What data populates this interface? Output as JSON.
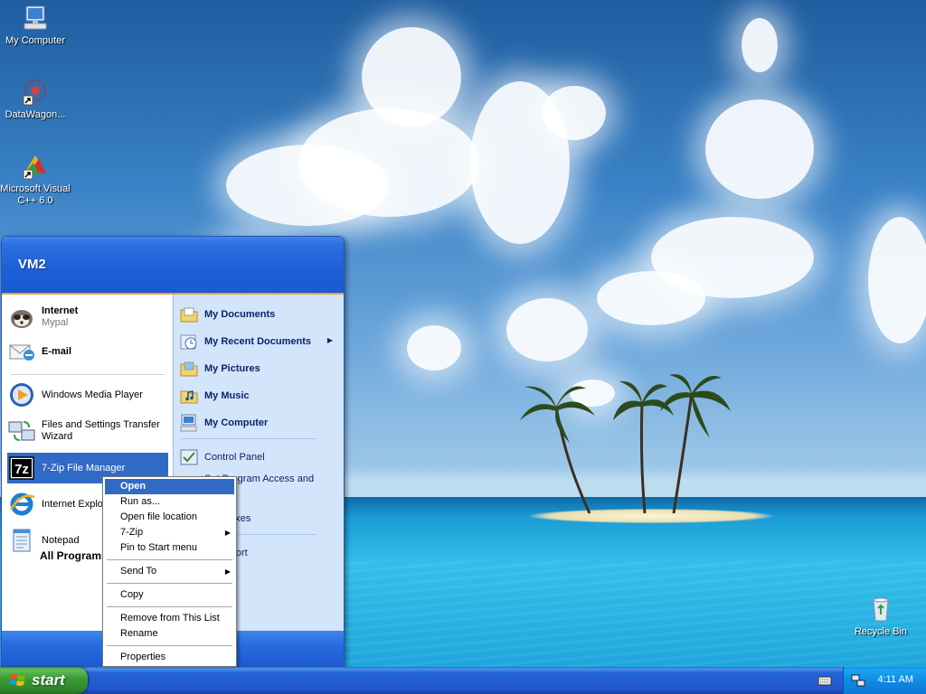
{
  "desktop": {
    "icons": [
      {
        "label": "My Computer"
      },
      {
        "label": "DataWagon..."
      },
      {
        "label": "Microsoft Visual C++ 6.0"
      },
      {
        "label": "Recycle Bin"
      }
    ]
  },
  "start_menu": {
    "user_name": "VM2",
    "pinned": [
      {
        "title": "Internet",
        "subtitle": "Mypal"
      },
      {
        "title": "E-mail"
      }
    ],
    "recent": [
      {
        "label": "Windows Media Player"
      },
      {
        "label": "Files and Settings Transfer Wizard"
      },
      {
        "label": "7-Zip File Manager"
      },
      {
        "label": "Internet Explo"
      },
      {
        "label": "Notepad"
      }
    ],
    "all_programs": "All Programs",
    "right": [
      {
        "label": "My Documents"
      },
      {
        "label": "My Recent Documents"
      },
      {
        "label": "My Pictures"
      },
      {
        "label": "My Music"
      },
      {
        "label": "My Computer"
      },
      {
        "label": "Control Panel"
      },
      {
        "label": "Set Program Access and"
      },
      {
        "label": "s"
      },
      {
        "label": "and Faxes"
      },
      {
        "label": "d Support"
      }
    ]
  },
  "context_menu": {
    "items": [
      {
        "label": "Open"
      },
      {
        "label": "Run as..."
      },
      {
        "label": "Open file location"
      },
      {
        "label": "7-Zip"
      },
      {
        "label": "Pin to Start menu"
      },
      {
        "label": "Send To"
      },
      {
        "label": "Copy"
      },
      {
        "label": "Remove from This List"
      },
      {
        "label": "Rename"
      },
      {
        "label": "Properties"
      }
    ]
  },
  "taskbar": {
    "start_label": "start",
    "clock": "4:11 AM"
  },
  "colors": {
    "selection": "#316ac5",
    "start_green": "#3a9a36",
    "xp_blue": "#1d5fd6",
    "tray_blue": "#0f8be3"
  }
}
